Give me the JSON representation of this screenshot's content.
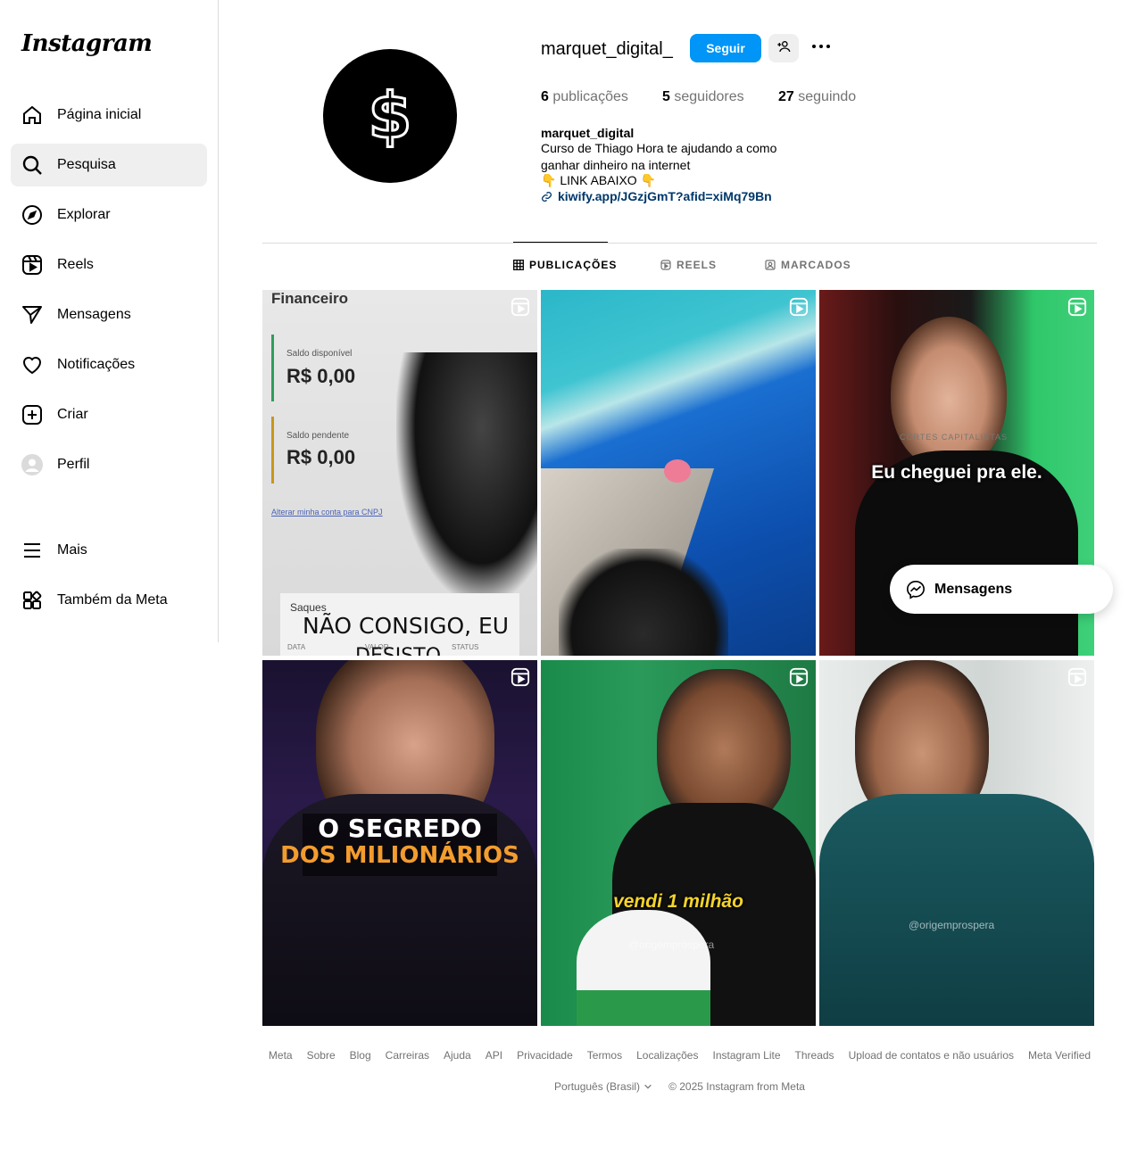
{
  "app": {
    "logo_text": "Instagram"
  },
  "sidebar": {
    "items": [
      {
        "label": "Página inicial",
        "icon": "home-icon"
      },
      {
        "label": "Pesquisa",
        "icon": "search-icon"
      },
      {
        "label": "Explorar",
        "icon": "compass-icon"
      },
      {
        "label": "Reels",
        "icon": "reels-icon"
      },
      {
        "label": "Mensagens",
        "icon": "send-icon"
      },
      {
        "label": "Notificações",
        "icon": "heart-icon"
      },
      {
        "label": "Criar",
        "icon": "plus-square-icon"
      },
      {
        "label": "Perfil",
        "icon": "profile-avatar-icon"
      },
      {
        "label": "Mais",
        "icon": "menu-icon"
      },
      {
        "label": "Também da Meta",
        "icon": "meta-grid-icon"
      }
    ],
    "active_index": 1
  },
  "profile": {
    "username": "marquet_digital_",
    "follow_label": "Seguir",
    "stats": {
      "posts_count": "6",
      "posts_label": "publicações",
      "followers_count": "5",
      "followers_label": "seguidores",
      "following_count": "27",
      "following_label": "seguindo"
    },
    "bio": {
      "name": "marquet_digital",
      "line1": "Curso de Thiago Hora te ajudando a como",
      "line2": "ganhar dinheiro na internet",
      "line3": "👇 LINK ABAIXO 👇",
      "link": "kiwify.app/JGzjGmT?afid=xiMq79Bn"
    },
    "avatar_symbol": "$"
  },
  "tabs": [
    {
      "label": "PUBLICAÇÕES",
      "icon": "grid-icon",
      "active": true
    },
    {
      "label": "REELS",
      "icon": "reels-icon",
      "active": false
    },
    {
      "label": "MARCADOS",
      "icon": "tagged-icon",
      "active": false
    }
  ],
  "posts": [
    {
      "title": "Financeiro",
      "label1": "Saldo disponível",
      "value1": "R$ 0,00",
      "label2": "Saldo pendente",
      "value2": "R$ 0,00",
      "link": "Alterar minha conta para CNPJ",
      "saques": "Saques",
      "caption": "NÃO CONSIGO, EU",
      "caption2": "DESISTO",
      "col1": "DATA",
      "col2": "VALOR",
      "col3": "STATUS"
    },
    {
      "caption": ""
    },
    {
      "caption": "Eu cheguei pra ele.",
      "watermark": "CORTES CAPITALISTAS"
    },
    {
      "caption_line1": "O SEGREDO",
      "caption_line2": "DOS MILIONÁRIOS"
    },
    {
      "caption": "vendi 1 milhão",
      "watermark": "@origemprospera"
    },
    {
      "watermark": "@origemprospera"
    }
  ],
  "footer": {
    "links": [
      "Meta",
      "Sobre",
      "Blog",
      "Carreiras",
      "Ajuda",
      "API",
      "Privacidade",
      "Termos",
      "Localizações",
      "Instagram Lite",
      "Threads",
      "Upload de contatos e não usuários",
      "Meta Verified"
    ],
    "language": "Português (Brasil)",
    "copyright": "© 2025 Instagram from Meta"
  },
  "messages_pill": {
    "label": "Mensagens"
  }
}
